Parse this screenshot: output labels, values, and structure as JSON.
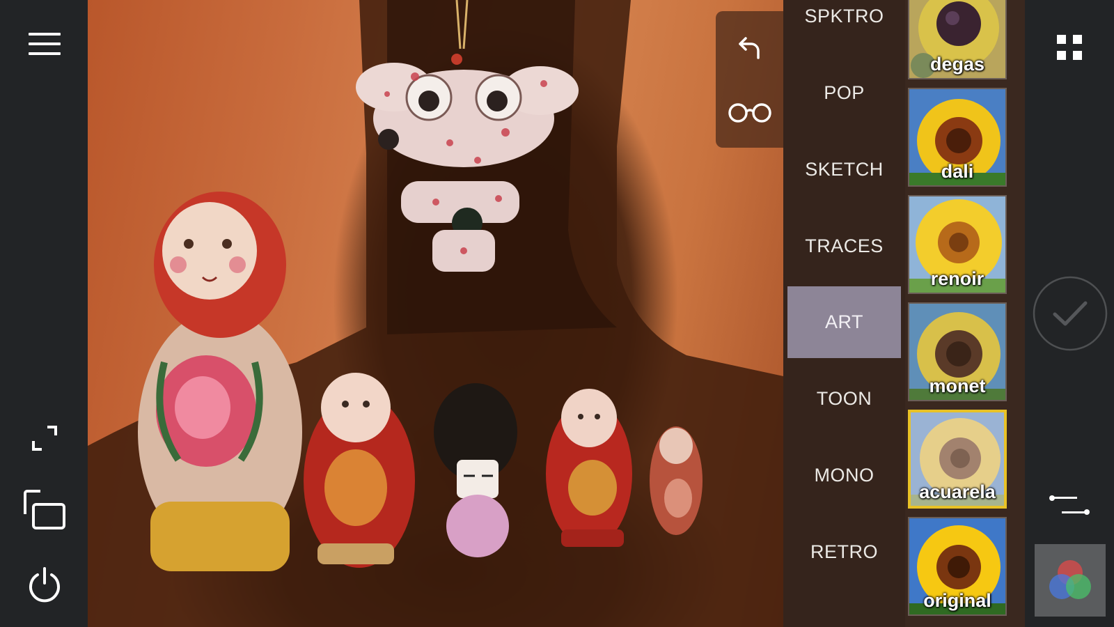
{
  "left_toolbar": {
    "menu_icon": "hamburger-menu-icon",
    "fullscreen_icon": "expand-icon",
    "compare_icon": "copy-layers-icon",
    "power_icon": "power-icon"
  },
  "floating_tools": {
    "undo_icon": "undo-icon",
    "preview_icon": "glasses-icon"
  },
  "effect_categories": [
    {
      "label": "SPKTRO",
      "active": false
    },
    {
      "label": "POP",
      "active": false
    },
    {
      "label": "SKETCH",
      "active": false
    },
    {
      "label": "TRACES",
      "active": false
    },
    {
      "label": "ART",
      "active": true
    },
    {
      "label": "TOON",
      "active": false
    },
    {
      "label": "MONO",
      "active": false
    },
    {
      "label": "RETRO",
      "active": false
    }
  ],
  "style_thumbnails": [
    {
      "label": "degas",
      "selected": false
    },
    {
      "label": "dali",
      "selected": false
    },
    {
      "label": "renoir",
      "selected": false
    },
    {
      "label": "monet",
      "selected": false
    },
    {
      "label": "acuarela",
      "selected": true
    },
    {
      "label": "original",
      "selected": false
    }
  ],
  "right_toolbar": {
    "grid_icon": "grid-icon",
    "confirm_icon": "checkmark-icon",
    "adjust_icon": "sliders-icon",
    "color_icon": "rgb-circles-icon"
  },
  "colors": {
    "active_category": "#8d8597",
    "selected_thumb_border": "#e8c226",
    "toolbar_bg": "#222426"
  }
}
